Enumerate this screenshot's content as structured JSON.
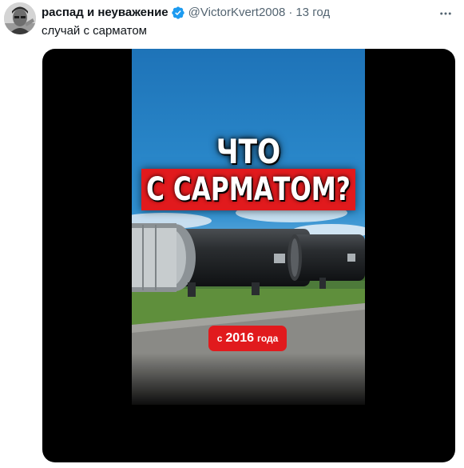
{
  "tweet": {
    "author": {
      "display_name": "распад и неуважение",
      "handle": "@VictorKvert2008",
      "verified_icon": "verified-badge-icon",
      "verified_color": "#1d9bf0"
    },
    "separator": "·",
    "time": "13 год",
    "text": "случай с сарматом",
    "more_icon": "more-horizontal-icon"
  },
  "media": {
    "headline_line1": "ЧТО",
    "headline_line2": "С САРМАТОМ?",
    "badge_prefix": "с",
    "badge_year": "2016",
    "badge_suffix": "года",
    "accent_color": "#e11a1d",
    "background_color": "#000000"
  }
}
